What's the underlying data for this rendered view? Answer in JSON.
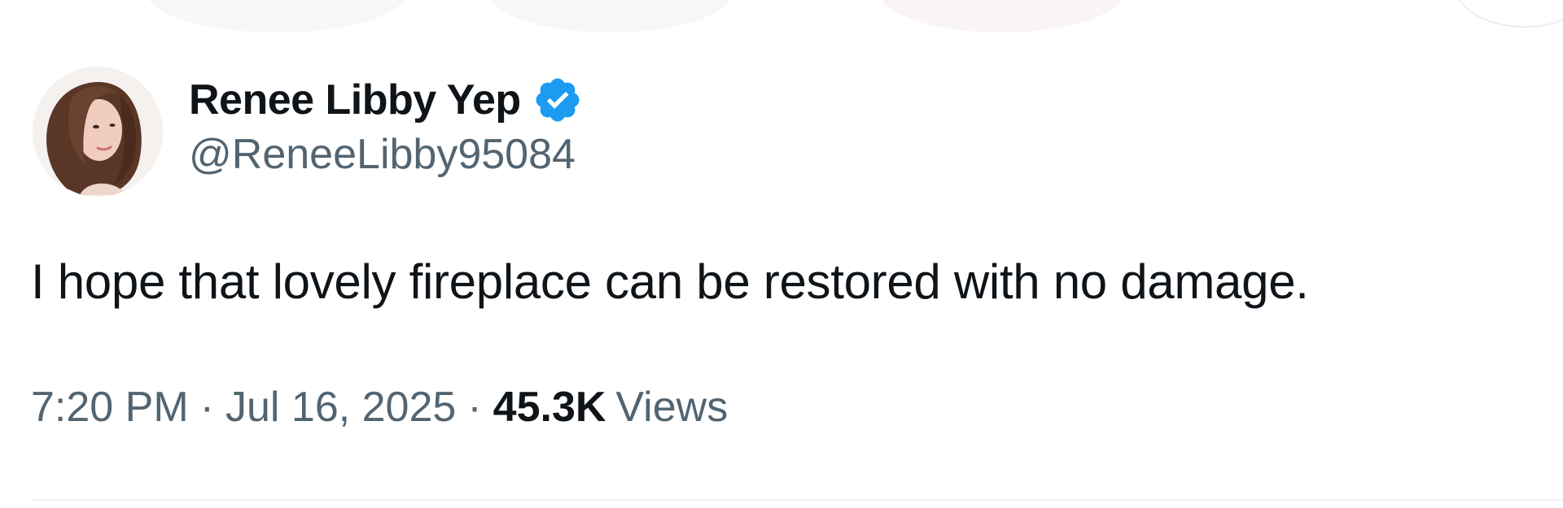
{
  "tweet": {
    "author": {
      "display_name": "Renee Libby Yep",
      "handle": "@ReneeLibby95084",
      "verified": true,
      "verified_icon": "verified-badge-icon",
      "verified_color": "#1d9bf0"
    },
    "text": "I hope that lovely fireplace can be restored with no damage.",
    "time": "7:20 PM",
    "date": "Jul 16, 2025",
    "separator": "·",
    "views_count": "45.3K",
    "views_label": "Views"
  },
  "colors": {
    "primary_text": "#0f1419",
    "secondary_text": "#536471",
    "divider": "#eff3f4"
  }
}
